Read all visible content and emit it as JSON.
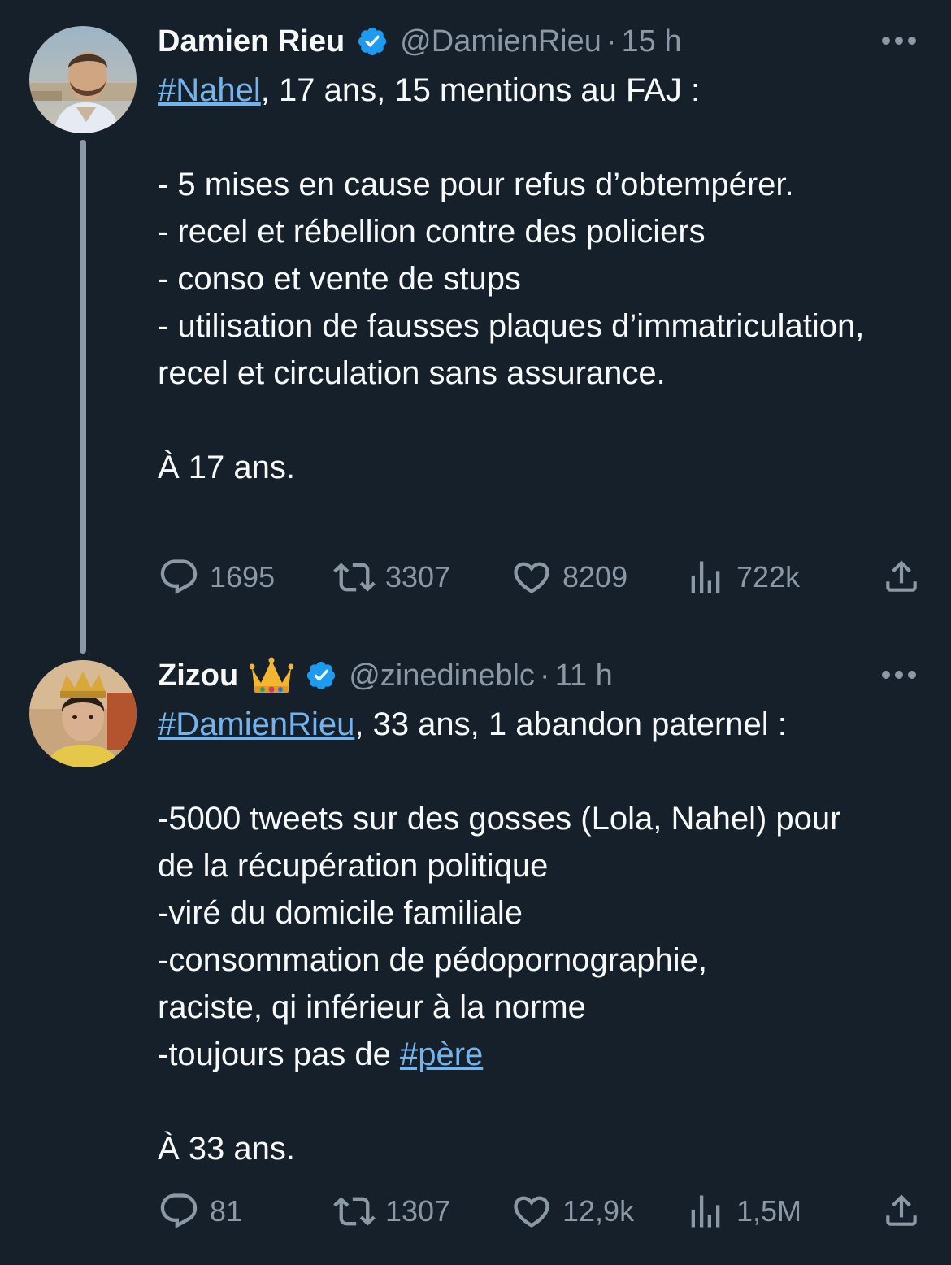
{
  "tweets": [
    {
      "author": {
        "name": "Damien Rieu",
        "emoji": "",
        "handle": "@DamienRieu",
        "time": "15 h"
      },
      "hashtag": "#Nahel",
      "intro": ", 17 ans, 15 mentions au FAJ :",
      "lines": [
        "- 5 mises en cause pour refus d’obtempérer.",
        "- recel et rébellion contre des policiers",
        "- conso et vente de stups",
        "- utilisation de fausses plaques d’immatriculation, recel et circulation sans assurance."
      ],
      "closing": "À 17 ans.",
      "stats": {
        "replies": "1695",
        "retweets": "3307",
        "likes": "8209",
        "views": "722k"
      }
    },
    {
      "author": {
        "name": "Zizou",
        "emoji": "👑",
        "handle": "@zinedineblc",
        "time": "11 h"
      },
      "hashtag": "#DamienRieu",
      "intro": ", 33 ans, 1 abandon paternel :",
      "lines": [
        "-5000 tweets sur des gosses (Lola, Nahel) pour de la récupération politique",
        "-viré du domicile familiale",
        "-consommation de pédopornographie, raciste, qi inférieur à la norme"
      ],
      "last_line_prefix": "-toujours pas de ",
      "last_line_hashtag": "#père",
      "closing": "À 33 ans.",
      "stats": {
        "replies": "81",
        "retweets": "1307",
        "likes": "12,9k",
        "views": "1,5M"
      }
    }
  ],
  "separator": "·",
  "colors": {
    "background": "#15202b",
    "text": "#f7f9f9",
    "secondary": "#8b98a5",
    "link": "#74b3ec",
    "verified": "#1d9bf0"
  },
  "icons": {
    "reply": "reply-icon",
    "retweet": "retweet-icon",
    "like": "heart-icon",
    "views": "views-icon",
    "share": "share-icon",
    "more": "more-icon",
    "verified": "verified-badge-icon"
  }
}
